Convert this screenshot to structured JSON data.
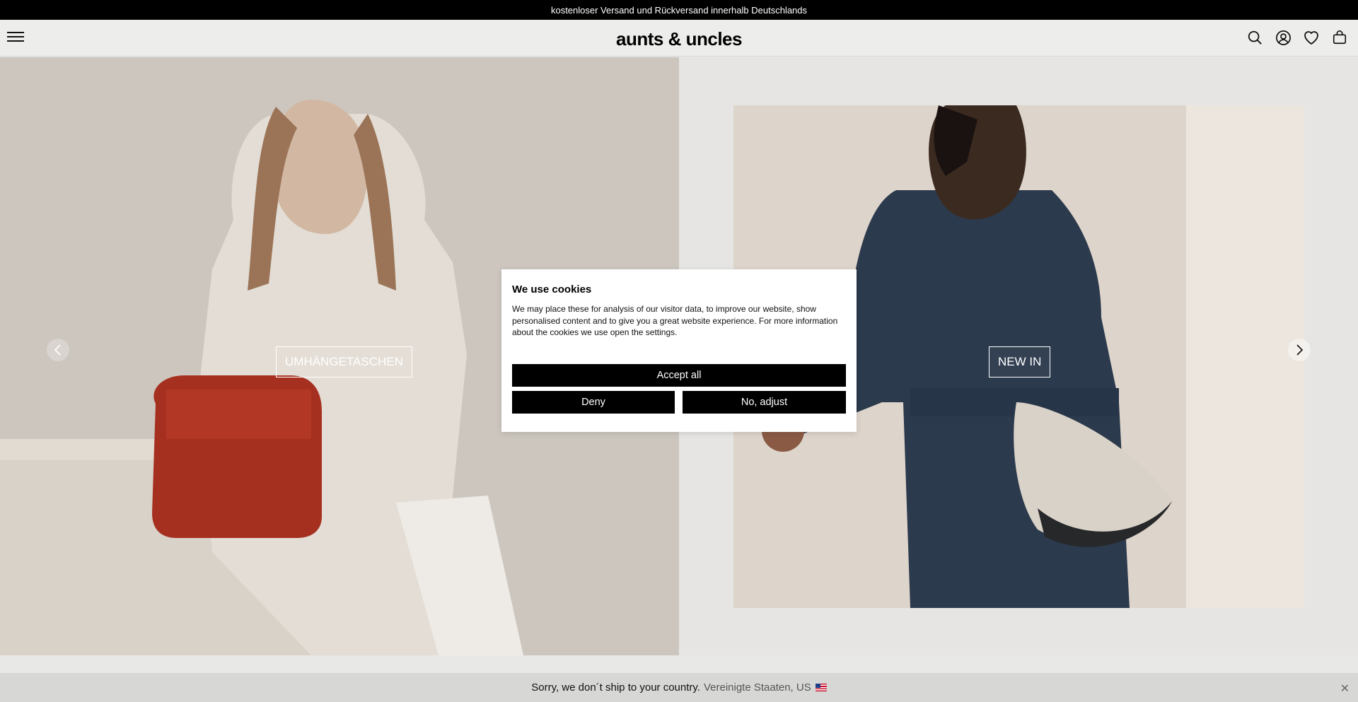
{
  "announcement": "kostenloser Versand und Rückversand innerhalb Deutschlands",
  "header": {
    "logo": "aunts & uncles",
    "icons": [
      "menu-icon",
      "search-icon",
      "account-icon",
      "wishlist-icon",
      "cart-icon"
    ]
  },
  "hero": {
    "left_button": "UMHÄNGETASCHEN",
    "right_button": "NEW IN"
  },
  "cookie": {
    "title": "We use cookies",
    "text": "We may place these for analysis of our visitor data, to improve our website, show personalised content and to give you a great website experience. For more information about the cookies we use open the settings.",
    "accept": "Accept all",
    "deny": "Deny",
    "adjust": "No, adjust"
  },
  "shipping": {
    "message": "Sorry, we don´t ship to your country.",
    "country": "Vereinigte Staaten, US"
  },
  "colors": {
    "announcement_bg": "#000000",
    "button_bg": "#000000",
    "page_bg": "#e8e8e7"
  }
}
